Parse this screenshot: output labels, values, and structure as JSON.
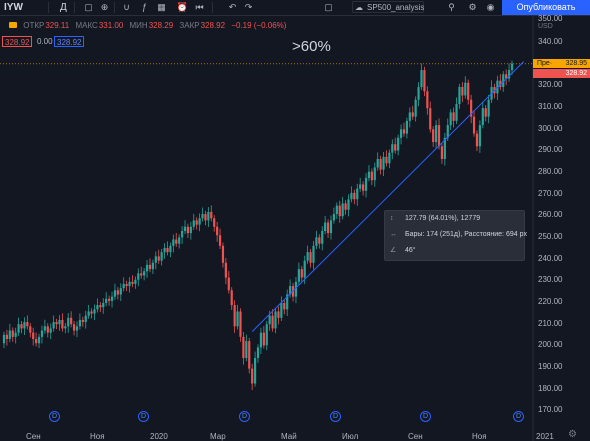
{
  "toolbar": {
    "symbol": "IYW",
    "interval": "Д",
    "layout_name": "SP500_analysis",
    "publish_label": "Опубликовать"
  },
  "legend": {
    "open_label": "ОТКР",
    "open_value": "329.11",
    "high_label": "МАКС",
    "high_value": "331.00",
    "low_label": "МИН",
    "low_value": "328.29",
    "close_label": "ЗАКР",
    "close_value": "328.92",
    "change": "−0.19 (−0.06%)",
    "bid": "328.92",
    "spread": "0.00",
    "ask": "328.92"
  },
  "annotation": ">60%",
  "measure": {
    "price_change": "127.79 (64.01%), 12779",
    "bars": "Бары: 174 (251д), Расстояние: 694 px",
    "angle": "46°"
  },
  "price_axis": {
    "ticks": [
      "350.00",
      "340.00",
      "330.00",
      "320.00",
      "310.00",
      "300.00",
      "290.00",
      "280.00",
      "270.00",
      "260.00",
      "250.00",
      "240.00",
      "230.00",
      "220.00",
      "210.00",
      "200.00",
      "190.00",
      "180.00",
      "170.00"
    ],
    "currency": "USD",
    "last_label": "Пре·",
    "last_value": "328.95",
    "close_value": "328.92"
  },
  "time_axis": {
    "ticks": [
      "Сен",
      "Ноя",
      "2020",
      "Мар",
      "Май",
      "Июл",
      "Сен",
      "Ноя",
      "2021"
    ]
  },
  "dividend_badge": "D",
  "colors": {
    "background": "#131722",
    "up": "#26a69a",
    "down": "#ef5350",
    "trendline": "#2962ff",
    "accent": "#2962ff",
    "last_price": "#f7a600"
  },
  "chart_data": {
    "type": "candlestick",
    "series": [
      {
        "name": "IYW",
        "values": [
          [
            197,
            201
          ],
          [
            201,
            199
          ],
          [
            199,
            203
          ],
          [
            203,
            200
          ],
          [
            200,
            202
          ],
          [
            202,
            206
          ],
          [
            206,
            204
          ],
          [
            204,
            207
          ],
          [
            207,
            205
          ],
          [
            205,
            202
          ],
          [
            202,
            199
          ],
          [
            199,
            197
          ],
          [
            197,
            200
          ],
          [
            200,
            203
          ],
          [
            203,
            205
          ],
          [
            205,
            202
          ],
          [
            202,
            204
          ],
          [
            204,
            207
          ],
          [
            207,
            206
          ],
          [
            206,
            208
          ],
          [
            208,
            204
          ],
          [
            204,
            205
          ],
          [
            205,
            209
          ],
          [
            209,
            206
          ],
          [
            206,
            203
          ],
          [
            203,
            205
          ],
          [
            205,
            208
          ],
          [
            208,
            207
          ],
          [
            207,
            210
          ],
          [
            210,
            212
          ],
          [
            212,
            211
          ],
          [
            211,
            213
          ],
          [
            213,
            215
          ],
          [
            215,
            214
          ],
          [
            214,
            216
          ],
          [
            216,
            218
          ],
          [
            218,
            217
          ],
          [
            217,
            219
          ],
          [
            219,
            222
          ],
          [
            222,
            220
          ],
          [
            220,
            223
          ],
          [
            223,
            225
          ],
          [
            225,
            224
          ],
          [
            224,
            226
          ],
          [
            226,
            225
          ],
          [
            225,
            227
          ],
          [
            227,
            230
          ],
          [
            230,
            229
          ],
          [
            229,
            231
          ],
          [
            231,
            234
          ],
          [
            234,
            232
          ],
          [
            232,
            235
          ],
          [
            235,
            238
          ],
          [
            238,
            236
          ],
          [
            236,
            240
          ],
          [
            240,
            242
          ],
          [
            242,
            240
          ],
          [
            240,
            243
          ],
          [
            243,
            246
          ],
          [
            246,
            244
          ],
          [
            244,
            247
          ],
          [
            247,
            250
          ],
          [
            250,
            252
          ],
          [
            252,
            249
          ],
          [
            249,
            252
          ],
          [
            252,
            255
          ],
          [
            255,
            253
          ],
          [
            253,
            256
          ],
          [
            256,
            258
          ],
          [
            258,
            255
          ],
          [
            255,
            259
          ],
          [
            259,
            256
          ],
          [
            256,
            252
          ],
          [
            252,
            248
          ],
          [
            248,
            243
          ],
          [
            243,
            235
          ],
          [
            235,
            228
          ],
          [
            228,
            222
          ],
          [
            222,
            215
          ],
          [
            215,
            205
          ],
          [
            205,
            212
          ],
          [
            212,
            200
          ],
          [
            200,
            190
          ],
          [
            190,
            198
          ],
          [
            198,
            185
          ],
          [
            185,
            178
          ],
          [
            178,
            190
          ],
          [
            190,
            195
          ],
          [
            195,
            202
          ],
          [
            202,
            196
          ],
          [
            196,
            206
          ],
          [
            206,
            210
          ],
          [
            210,
            204
          ],
          [
            204,
            212
          ],
          [
            212,
            209
          ],
          [
            209,
            216
          ],
          [
            216,
            213
          ],
          [
            213,
            220
          ],
          [
            220,
            224
          ],
          [
            224,
            219
          ],
          [
            219,
            226
          ],
          [
            226,
            232
          ],
          [
            232,
            228
          ],
          [
            228,
            236
          ],
          [
            236,
            240
          ],
          [
            240,
            235
          ],
          [
            235,
            243
          ],
          [
            243,
            247
          ],
          [
            247,
            244
          ],
          [
            244,
            250
          ],
          [
            250,
            254
          ],
          [
            254,
            249
          ],
          [
            249,
            255
          ],
          [
            255,
            258
          ],
          [
            258,
            262
          ],
          [
            262,
            257
          ],
          [
            257,
            263
          ],
          [
            263,
            260
          ],
          [
            260,
            265
          ],
          [
            265,
            268
          ],
          [
            268,
            265
          ],
          [
            265,
            270
          ],
          [
            270,
            272
          ],
          [
            272,
            269
          ],
          [
            269,
            275
          ],
          [
            275,
            278
          ],
          [
            278,
            274
          ],
          [
            274,
            280
          ],
          [
            280,
            284
          ],
          [
            284,
            279
          ],
          [
            279,
            285
          ],
          [
            285,
            282
          ],
          [
            282,
            287
          ],
          [
            287,
            291
          ],
          [
            291,
            288
          ],
          [
            288,
            294
          ],
          [
            294,
            298
          ],
          [
            298,
            296
          ],
          [
            296,
            302
          ],
          [
            302,
            306
          ],
          [
            306,
            304
          ],
          [
            304,
            312
          ],
          [
            312,
            318
          ],
          [
            318,
            326
          ],
          [
            326,
            316
          ],
          [
            316,
            308
          ],
          [
            308,
            298
          ],
          [
            298,
            292
          ],
          [
            292,
            300
          ],
          [
            300,
            290
          ],
          [
            290,
            284
          ],
          [
            284,
            294
          ],
          [
            294,
            300
          ],
          [
            300,
            306
          ],
          [
            306,
            302
          ],
          [
            302,
            310
          ],
          [
            310,
            318
          ],
          [
            318,
            314
          ],
          [
            314,
            320
          ],
          [
            320,
            312
          ],
          [
            312,
            304
          ],
          [
            304,
            296
          ],
          [
            296,
            290
          ],
          [
            290,
            300
          ],
          [
            300,
            308
          ],
          [
            308,
            304
          ],
          [
            304,
            312
          ],
          [
            312,
            318
          ],
          [
            318,
            315
          ],
          [
            315,
            321
          ],
          [
            321,
            318
          ],
          [
            318,
            324
          ],
          [
            324,
            322
          ],
          [
            322,
            326
          ],
          [
            326,
            329
          ]
        ]
      }
    ],
    "ylim": [
      165,
      352
    ],
    "trendline": {
      "from": [
        85,
        202.5
      ],
      "to": [
        178,
        330
      ]
    },
    "measure_from": [
      85,
      202.5
    ]
  }
}
